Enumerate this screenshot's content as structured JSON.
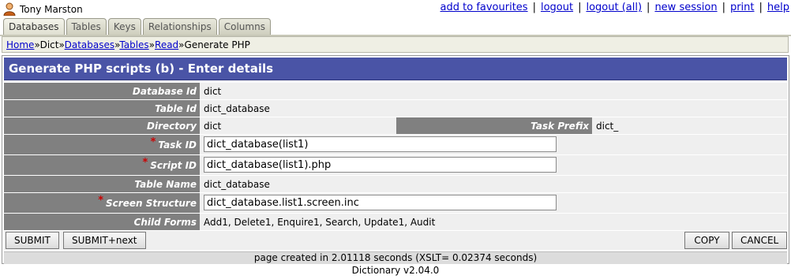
{
  "header": {
    "user_name": "Tony Marston",
    "user_icon": "person-icon",
    "links": [
      "add to favourites",
      "logout",
      "logout (all)",
      "new session",
      "print",
      "help"
    ]
  },
  "tabs": [
    {
      "label": "Databases",
      "active": true
    },
    {
      "label": "Tables",
      "active": false
    },
    {
      "label": "Keys",
      "active": false
    },
    {
      "label": "Relationships",
      "active": false
    },
    {
      "label": "Columns",
      "active": false
    }
  ],
  "breadcrumb": {
    "links": [
      "Home",
      "Dict",
      "Databases",
      "Tables",
      "Read"
    ],
    "separator": "»",
    "current": "Generate PHP"
  },
  "form": {
    "title": "Generate PHP scripts (b) - Enter details",
    "database_id": {
      "label": "Database Id",
      "value": "dict"
    },
    "table_id": {
      "label": "Table Id",
      "value": "dict_database"
    },
    "directory": {
      "label": "Directory",
      "value": "dict"
    },
    "task_prefix": {
      "label": "Task Prefix",
      "value": "dict_"
    },
    "task_id": {
      "label": "Task ID",
      "value": "dict_database(list1)",
      "required": "*"
    },
    "script_id": {
      "label": "Script ID",
      "value": "dict_database(list1).php",
      "required": "*"
    },
    "table_name": {
      "label": "Table Name",
      "value": "dict_database"
    },
    "screen_structure": {
      "label": "Screen Structure",
      "value": "dict_database.list1.screen.inc",
      "required": "*"
    },
    "child_forms": {
      "label": "Child Forms",
      "value": "Add1, Delete1, Enquire1, Search, Update1, Audit"
    }
  },
  "buttons": {
    "submit": "SUBMIT",
    "submit_next": "SUBMIT+next",
    "copy": "COPY",
    "cancel": "CANCEL"
  },
  "footer": {
    "timing": "page created in 2.01118 seconds (XSLT= 0.02374 seconds)",
    "version": "Dictionary v2.04.0"
  },
  "colors": {
    "title_bar": "#4a54a6",
    "label_cell": "#808080",
    "link": "#0000cc",
    "required_star": "#cc0000"
  }
}
